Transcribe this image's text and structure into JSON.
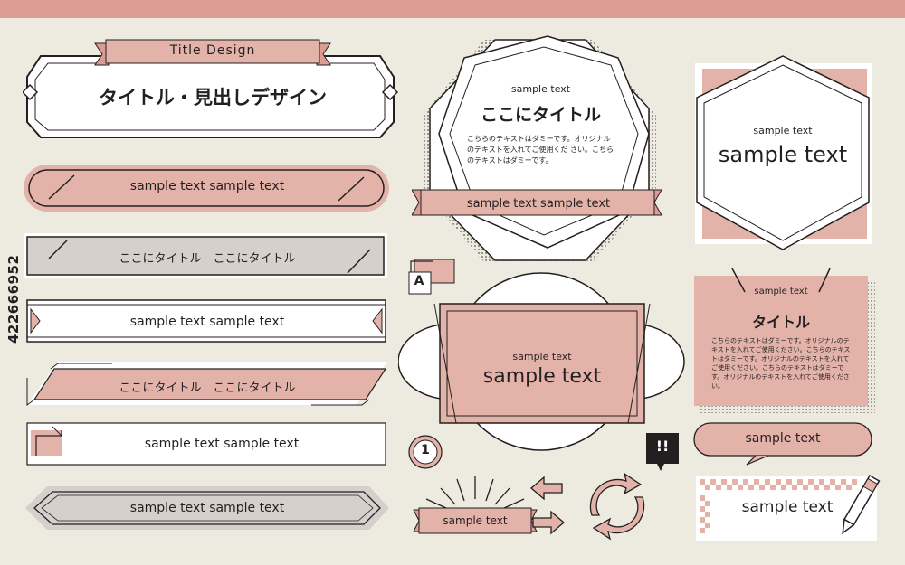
{
  "title_design": {
    "ribbon_label": "Title Design",
    "main_heading": "タイトル・見出しデザイン"
  },
  "bars": {
    "bar1": "sample text sample text",
    "bar2": "ここにタイトル　ここにタイトル",
    "bar3": "sample text sample text",
    "bar4": "ここにタイトル　ここにタイトル",
    "bar5": "sample text sample text",
    "bar6": "sample text sample text"
  },
  "octagon_card": {
    "small": "sample text",
    "heading": "ここにタイトル",
    "body": "こちらのテキストはダミーです。オリジナルのテキストを入れてご使用くだ さい。こちらのテキストはダミーです。",
    "ribbon": "sample text sample text"
  },
  "hexagon_card": {
    "small": "sample text",
    "heading": "sample text"
  },
  "badges": {
    "letter": "A",
    "number": "1",
    "exclaim": "!!"
  },
  "round_card": {
    "small": "sample text",
    "heading": "sample text"
  },
  "pink_card": {
    "small": "sample text",
    "heading": "タイトル",
    "body": "こちらのテキストはダミーです。オリジナルのテキストを入れてご使用ください。こちらのテキストはダミーです。オリジナルのテキストを入れてご使用ください。こちらのテキストはダミーです。オリジナルのテキストを入れてご使用ください。"
  },
  "speech_pill": "sample text",
  "pen_card": "sample text",
  "small_ribbon": "sample text",
  "stock_id": "422666952",
  "colors": {
    "pink": "#e3b3a9",
    "pink_dark": "#dd9c93",
    "gray": "#d6cfcc",
    "ink": "#231f20",
    "background": "#edebdf"
  }
}
